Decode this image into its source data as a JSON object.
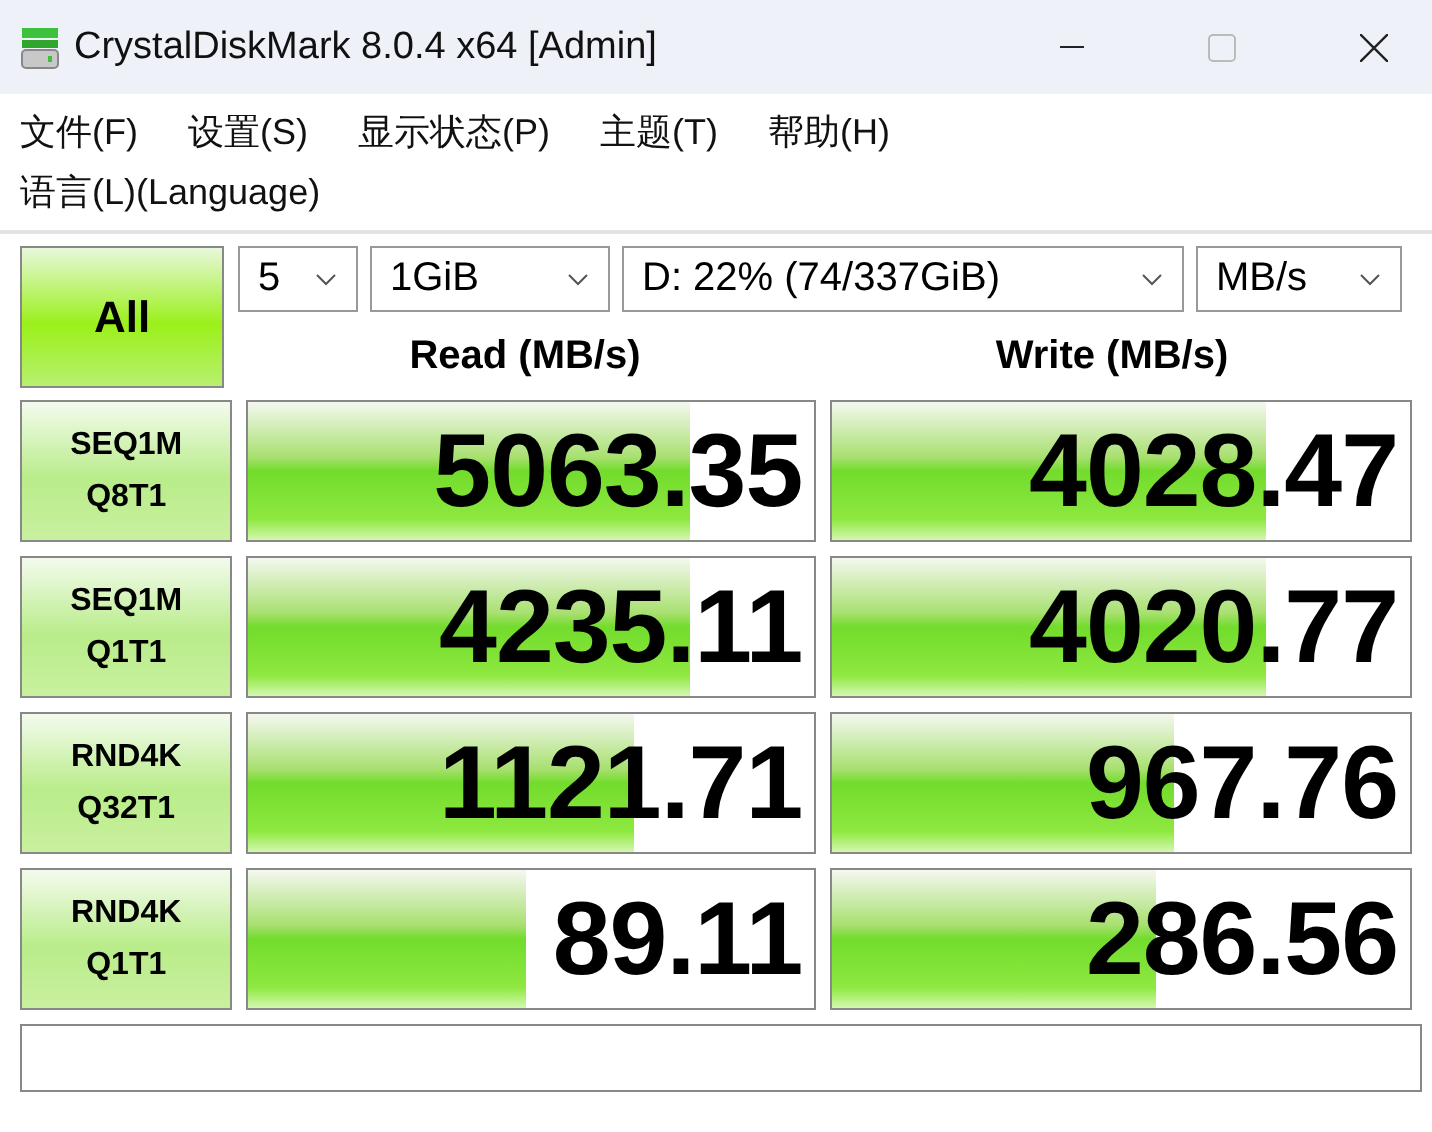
{
  "window": {
    "title": "CrystalDiskMark 8.0.4 x64 [Admin]"
  },
  "menu": [
    "文件(F)",
    "设置(S)",
    "显示状态(P)",
    "主题(T)",
    "帮助(H)",
    "语言(L)(Language)"
  ],
  "all_button": "All",
  "selectors": [
    {
      "kind": "count",
      "value": "5"
    },
    {
      "kind": "size",
      "value": "1GiB"
    },
    {
      "kind": "drive",
      "value": "D: 22% (74/337GiB)"
    },
    {
      "kind": "unit",
      "value": "MB/s"
    }
  ],
  "columns": [
    "Read (MB/s)",
    "Write (MB/s)"
  ],
  "rows": [
    {
      "test": [
        "SEQ1M",
        "Q8T1"
      ],
      "read": {
        "value": "5063.35",
        "level": 0.78
      },
      "write": {
        "value": "4028.47",
        "level": 0.75
      }
    },
    {
      "test": [
        "SEQ1M",
        "Q1T1"
      ],
      "read": {
        "value": "4235.11",
        "level": 0.78
      },
      "write": {
        "value": "4020.77",
        "level": 0.75
      }
    },
    {
      "test": [
        "RND4K",
        "Q32T1"
      ],
      "read": {
        "value": "1121.71",
        "level": 0.68
      },
      "write": {
        "value": "967.76",
        "level": 0.59
      }
    },
    {
      "test": [
        "RND4K",
        "Q1T1"
      ],
      "read": {
        "value": "89.11",
        "level": 0.49
      },
      "write": {
        "value": "286.56",
        "level": 0.56
      }
    }
  ]
}
